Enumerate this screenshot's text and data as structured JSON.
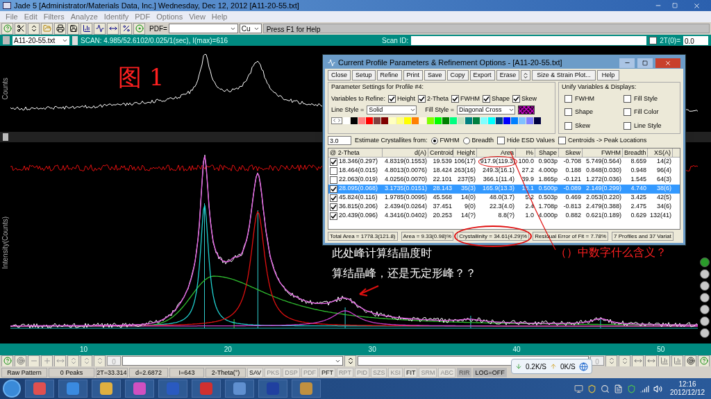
{
  "window": {
    "title": "Jade 5 [Administrator/Materials Data, Inc.] Wednesday, Dec 12, 2012 [A11-20-55.txt]"
  },
  "menu": [
    "File",
    "Edit",
    "Filters",
    "Analyze",
    "Identify",
    "PDF",
    "Options",
    "View",
    "Help"
  ],
  "toolbar": {
    "pdf_label": "PDF=",
    "element": "Cu",
    "hint": "Press F1 for Help"
  },
  "scan_bar": {
    "file": "A11-20-55.txt",
    "scan": "SCAN: 4.985/52.6102/0.025/1(sec), I(max)=616",
    "scan_id_label": "Scan ID:",
    "offset_label": "2T(0)=",
    "offset_checked": false,
    "offset_value": "0.0"
  },
  "top_plot": {
    "ylabel": "Counts"
  },
  "main_plot": {
    "ylabel": "Intensity(Counts)",
    "x_labels": [
      "10",
      "20",
      "30",
      "40",
      "50"
    ]
  },
  "annotations": {
    "figure_label": "图 1",
    "note_1": "此处峰计算结晶度时",
    "note_2": "算结晶峰，还是无定形峰？？",
    "note_3": "（）中数字什么含义？"
  },
  "dialog": {
    "title": "Current Profile Parameters & Refinement Options - [A11-20-55.txt]",
    "buttons": [
      "Close",
      "Setup",
      "Refine",
      "Print",
      "Save",
      "Copy",
      "Export",
      "Erase"
    ],
    "buttons_after": [
      "Size & Strain Plot...",
      "Help"
    ],
    "params_title": "Parameter Settings for Profile #4:",
    "refine_label": "Variables to Refine:",
    "variables": [
      {
        "label": "Height",
        "checked": true
      },
      {
        "label": "2-Theta",
        "checked": true
      },
      {
        "label": "FWHM",
        "checked": true
      },
      {
        "label": "Shape",
        "checked": true
      },
      {
        "label": "Skew",
        "checked": true
      }
    ],
    "line_style_label": "Line Style =",
    "line_style": "Solid",
    "fill_style_label": "Fill Style =",
    "fill_style": "Diagonal Cross",
    "palette": [
      {
        "color": "#ffffff"
      },
      {
        "color": "#000000"
      },
      {
        "color": "#ff8080"
      },
      {
        "color": "#ff0000"
      },
      {
        "color": "#804040"
      },
      {
        "color": "#800000"
      },
      {
        "color": "#ffffc0"
      },
      {
        "color": "#ffff80"
      },
      {
        "color": "#ffff00"
      },
      {
        "color": "#ff8000"
      },
      {
        "color": "#fff8e0"
      },
      {
        "color": "#80ff00"
      },
      {
        "color": "#00ff00"
      },
      {
        "color": "#008000"
      },
      {
        "color": "#00ff80"
      },
      {
        "color": "#c0e0c0"
      },
      {
        "color": "#008080"
      },
      {
        "color": "#008040"
      },
      {
        "color": "#80ffff"
      },
      {
        "color": "#00ffff"
      },
      {
        "color": "#004080"
      },
      {
        "color": "#0000ff"
      },
      {
        "color": "#0080ff"
      },
      {
        "color": "#80c0ff"
      },
      {
        "color": "#8080ff"
      },
      {
        "color": "#000040"
      }
    ],
    "unify_title": "Unify Variables & Displays:",
    "unify": [
      {
        "label": "FWHM",
        "checked": false
      },
      {
        "label": "Fill Style",
        "checked": false
      },
      {
        "label": "Shape",
        "checked": false
      },
      {
        "label": "Fill Color",
        "checked": false
      },
      {
        "label": "Skew",
        "checked": false
      },
      {
        "label": "Line Style",
        "checked": false
      }
    ],
    "crystallite_value": "3.0",
    "crystallite_label": "Estimate Crystallites from:",
    "radios": [
      {
        "label": "FWHM",
        "selected": true
      },
      {
        "label": "Breadth",
        "selected": false
      }
    ],
    "options": [
      {
        "label": "Hide ESD Values",
        "checked": false
      },
      {
        "label": "Centroids -> Peak Locations",
        "checked": false
      }
    ],
    "table": {
      "columns": [
        "@ 2-Theta",
        "d(A)",
        "Centroid",
        "Height",
        "Area",
        "I%",
        "Shape",
        "Skew",
        "FWHM",
        "Breadth",
        "XS(A)"
      ],
      "rows": [
        {
          "checked": true,
          "selected": false,
          "cells": [
            "18.346(0.297)",
            "4.8319(0.1553)",
            "19.539",
            "106(17)",
            "917.9(119.3)",
            "100.0",
            "0.903p",
            "-0.708",
            "5.749(0.564)",
            "8.659",
            "14(2)"
          ]
        },
        {
          "checked": false,
          "selected": false,
          "cells": [
            "18.464(0.015)",
            "4.8013(0.0076)",
            "18.424",
            "263(16)",
            "249.3(16.1)",
            "27.2",
            "4.000p",
            "0.188",
            "0.848(0.030)",
            "0.948",
            "96(4)"
          ]
        },
        {
          "checked": false,
          "selected": false,
          "cells": [
            "22.063(0.019)",
            "4.0256(0.0070)",
            "22.101",
            "237(5)",
            "366.1(11.4)",
            "39.9",
            "1.865p",
            "-0.121",
            "1.272(0.036)",
            "1.545",
            "64(3)"
          ]
        },
        {
          "checked": true,
          "selected": true,
          "cells": [
            "28.095(0.068)",
            "3.1735(0.0151)",
            "28.143",
            "35(3)",
            "165.9(13.3)",
            "18.1",
            "0.500p",
            "-0.089",
            "2.149(0.299)",
            "4.740",
            "38(6)"
          ]
        },
        {
          "checked": true,
          "selected": false,
          "cells": [
            "45.824(0.116)",
            "1.9785(0.0095)",
            "45.568",
            "14(0)",
            "48.0(3.7)",
            "5.2",
            "0.503p",
            "0.469",
            "2.053(0.220)",
            "3.425",
            "42(5)"
          ]
        },
        {
          "checked": true,
          "selected": false,
          "cells": [
            "36.815(0.206)",
            "2.4394(0.0264)",
            "37.451",
            "9(0)",
            "22.3(4.0)",
            "2.4",
            "1.708p",
            "-0.813",
            "2.479(0.388)",
            "2.475",
            "34(6)"
          ]
        },
        {
          "checked": true,
          "selected": false,
          "cells": [
            "20.439(0.096)",
            "4.3416(0.0402)",
            "20.253",
            "14(?)",
            "8.8(?)",
            "1.0",
            "4.000p",
            "0.882",
            "0.621(0.189)",
            "0.629",
            "132(41)"
          ]
        }
      ]
    },
    "status": [
      "Total Area = 1778.3(121.8)",
      "Area = 9.33(0.98)%",
      "Crystallinity = 34.61(4.29)%",
      "Residual Error of Fit = 7.78%",
      "7 Profiles and 37 Variat"
    ]
  },
  "bottom_toolbar": {
    "count_1": "0",
    "count_2": "0"
  },
  "status_bar": [
    "Raw Pattern",
    "0 Peaks",
    "2T=33.314",
    "d=2.6872",
    "I=643",
    "2-Theta(°)"
  ],
  "toggles": [
    {
      "text": "SAV",
      "disabled": false,
      "pressed": false
    },
    {
      "text": "PKS",
      "disabled": true,
      "pressed": false
    },
    {
      "text": "DSP",
      "disabled": true,
      "pressed": false
    },
    {
      "text": "PDF",
      "disabled": true,
      "pressed": false
    },
    {
      "text": "PFT",
      "disabled": false,
      "pressed": false
    },
    {
      "text": "RPT",
      "disabled": true,
      "pressed": false
    },
    {
      "text": "PID",
      "disabled": true,
      "pressed": false
    },
    {
      "text": "SZS",
      "disabled": true,
      "pressed": false
    },
    {
      "text": "KSI",
      "disabled": true,
      "pressed": false
    },
    {
      "text": "FIT",
      "disabled": false,
      "pressed": false
    },
    {
      "text": "SRM",
      "disabled": true,
      "pressed": false
    },
    {
      "text": "ABC",
      "disabled": true,
      "pressed": false
    },
    {
      "text": "RIR",
      "disabled": true,
      "pressed": true
    },
    {
      "text": "LOG=OFF",
      "disabled": false,
      "pressed": true
    }
  ],
  "network": {
    "down": "0.2K/S",
    "up": "0K/S"
  },
  "clock": {
    "time": "12:16",
    "date": "2012/12/12"
  }
}
